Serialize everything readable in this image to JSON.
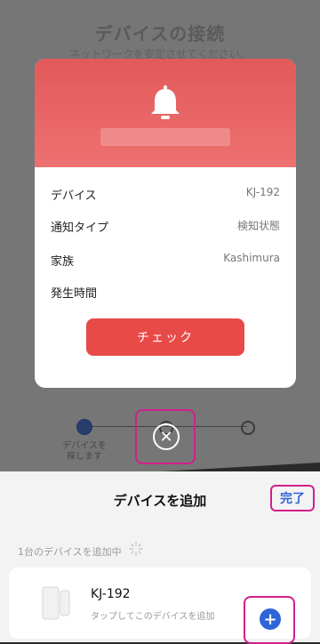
{
  "top_screen": {
    "title": "デバイスの接続",
    "subtitle": "ネットワークを安定させてください。",
    "steps": [
      {
        "label": "デバイスを\n探します"
      }
    ]
  },
  "modal": {
    "rows": [
      {
        "key": "デバイス",
        "value": "KJ-192"
      },
      {
        "key": "通知タイプ",
        "value": "検知状態"
      },
      {
        "key": "家族",
        "value": "Kashimura"
      },
      {
        "key": "発生時間",
        "value": ""
      }
    ],
    "check_label": "チェック",
    "icons": {
      "header": "bell-icon",
      "close": "close-icon"
    }
  },
  "bottom_screen": {
    "title": "デバイスを追加",
    "done_label": "完了",
    "adding_text": "1台のデバイスを追加中",
    "device": {
      "name": "KJ-192",
      "subtitle": "タップしてこのデバイスを追加"
    },
    "icons": {
      "spinner": "loading-spinner-icon",
      "add": "plus-circle-icon"
    }
  },
  "colors": {
    "modal_header": "#ea6565",
    "check_button": "#e84a48",
    "accent_blue": "#2f64d6",
    "highlight": "#d21f8c"
  }
}
